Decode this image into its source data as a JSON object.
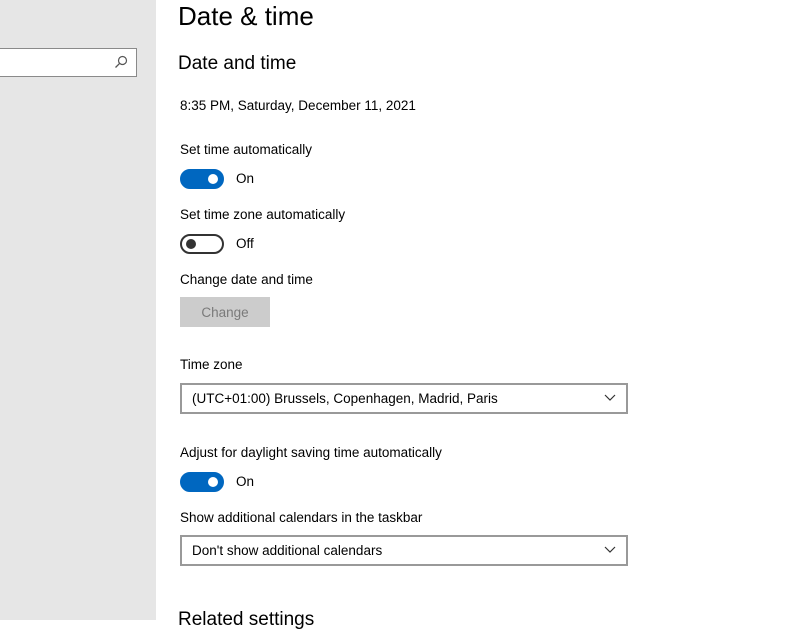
{
  "page": {
    "title": "Date & time"
  },
  "sidebar": {
    "search": {
      "value": "",
      "icon": "search-icon"
    }
  },
  "date_time": {
    "section_title": "Date and time",
    "current_datetime": "8:35 PM, Saturday, December 11, 2021",
    "set_time_automatically": {
      "label": "Set time automatically",
      "state": "On",
      "enabled": true
    },
    "set_time_zone_automatically": {
      "label": "Set time zone automatically",
      "state": "Off",
      "enabled": false
    },
    "change_date_time": {
      "label": "Change date and time",
      "button_label": "Change",
      "disabled": true
    },
    "time_zone": {
      "label": "Time zone",
      "selected": "(UTC+01:00) Brussels, Copenhagen, Madrid, Paris"
    },
    "daylight_saving": {
      "label": "Adjust for daylight saving time automatically",
      "state": "On",
      "enabled": true
    },
    "additional_calendars": {
      "label": "Show additional calendars in the taskbar",
      "selected": "Don't show additional calendars"
    }
  },
  "related_settings": {
    "title": "Related settings"
  },
  "colors": {
    "accent": "#0067c0",
    "sidebar_bg": "#e6e6e6",
    "disabled_button_bg": "#cccccc",
    "disabled_button_text": "#7a7a7a"
  }
}
